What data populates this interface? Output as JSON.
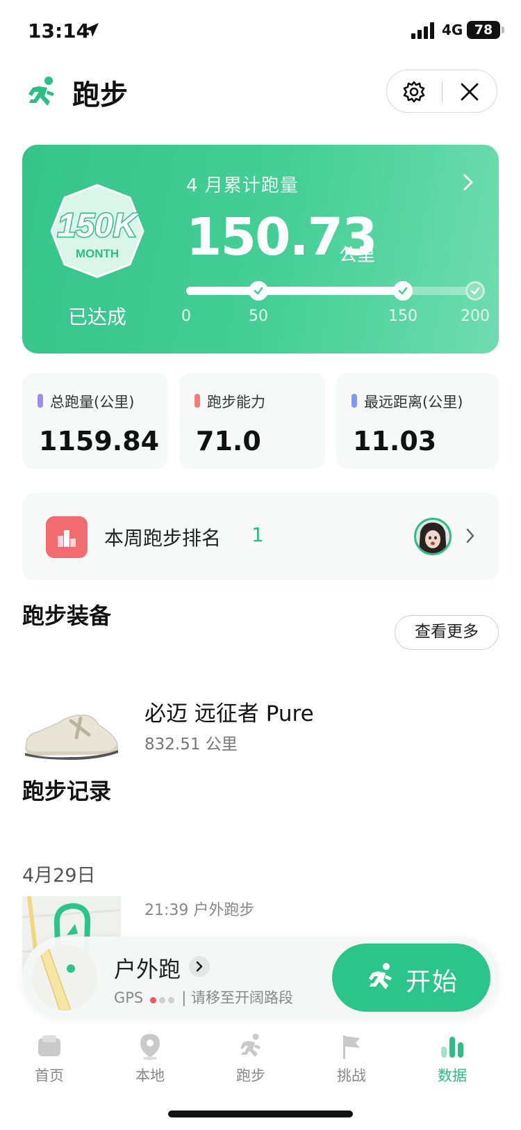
{
  "status_bar": {
    "time": "13:14",
    "network": "4G",
    "battery": "78"
  },
  "header": {
    "title": "跑步"
  },
  "banner": {
    "badge_top": "150K",
    "badge_bottom": "MONTH",
    "badge_status": "已达成",
    "label": "4 月累计跑量",
    "value": "150.73",
    "unit": "公里",
    "progress_value": 150.73,
    "progress_max": 200,
    "milestones": [
      "0",
      "50",
      "150",
      "200"
    ]
  },
  "stats": [
    {
      "label": "总跑量(公里)",
      "value": "1159.84",
      "color": "#9b8cf2"
    },
    {
      "label": "跑步能力",
      "value": "71.0",
      "color": "#f07c80"
    },
    {
      "label": "最远距离(公里)",
      "value": "11.03",
      "color": "#7d9cf0"
    }
  ],
  "ranking": {
    "label": "本周跑步排名",
    "value": "1"
  },
  "equipment": {
    "title": "跑步装备",
    "more_label": "查看更多",
    "shoe_name": "必迈 远征者 Pure",
    "shoe_distance": "832.51 公里"
  },
  "records": {
    "title": "跑步记录",
    "date": "4月29日",
    "entry_time": "21:39 户外跑步"
  },
  "run_panel": {
    "mode": "户外跑",
    "gps_label": "GPS",
    "gps_hint": "| 请移至开阔路段",
    "start_label": "开始"
  },
  "tabbar": [
    {
      "label": "首页",
      "icon": "home-icon"
    },
    {
      "label": "本地",
      "icon": "location-pin-icon"
    },
    {
      "label": "跑步",
      "icon": "runner-icon"
    },
    {
      "label": "挑战",
      "icon": "flag-icon"
    },
    {
      "label": "数据",
      "icon": "bar-chart-icon",
      "active": true
    }
  ],
  "colors": {
    "accent": "#2bbf86",
    "rank_icon": "#f26b70"
  }
}
